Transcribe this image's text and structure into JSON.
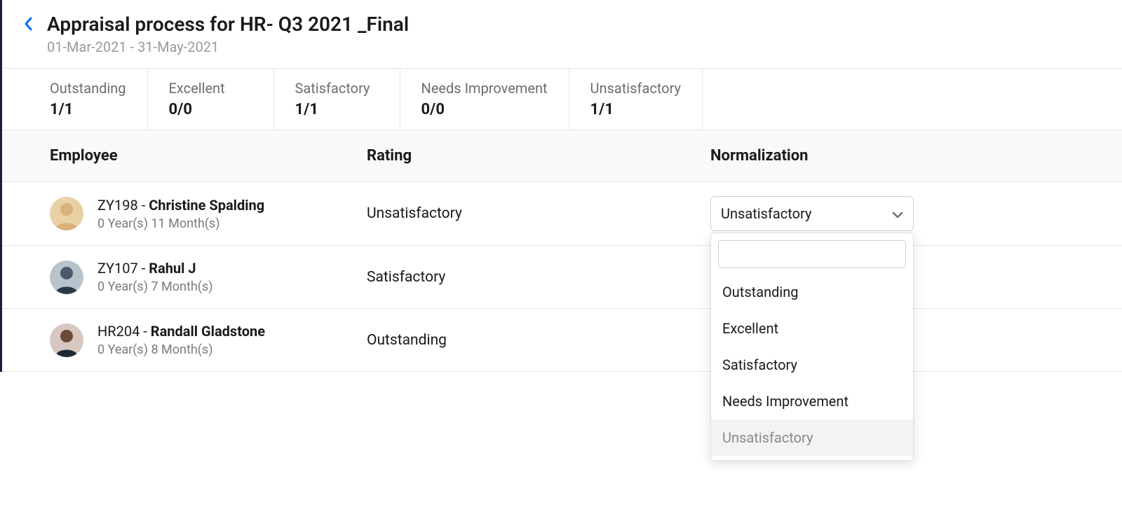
{
  "header": {
    "title": "Appraisal process for HR- Q3 2021 _Final",
    "date_range": "01-Mar-2021 - 31-May-2021"
  },
  "summary": [
    {
      "label": "Outstanding",
      "value": "1/1"
    },
    {
      "label": "Excellent",
      "value": "0/0"
    },
    {
      "label": "Satisfactory",
      "value": "1/1"
    },
    {
      "label": "Needs Improvement",
      "value": "0/0"
    },
    {
      "label": "Unsatisfactory",
      "value": "1/1"
    }
  ],
  "columns": {
    "employee": "Employee",
    "rating": "Rating",
    "normalization": "Normalization"
  },
  "rows": [
    {
      "code": "ZY198",
      "name": "Christine Spalding",
      "tenure": "0 Year(s) 11 Month(s)",
      "rating": "Unsatisfactory",
      "normalization": "Unsatisfactory"
    },
    {
      "code": "ZY107",
      "name": "Rahul J",
      "tenure": "0 Year(s) 7 Month(s)",
      "rating": "Satisfactory",
      "normalization": ""
    },
    {
      "code": "HR204",
      "name": "Randall Gladstone",
      "tenure": "0 Year(s) 8 Month(s)",
      "rating": "Outstanding",
      "normalization": ""
    }
  ],
  "dropdown": {
    "search_value": "",
    "options": [
      "Outstanding",
      "Excellent",
      "Satisfactory",
      "Needs Improvement",
      "Unsatisfactory"
    ],
    "highlighted": "Unsatisfactory"
  },
  "avatar_colors": [
    "#d8b27a",
    "#4a5a6a",
    "#6b4a3a"
  ]
}
